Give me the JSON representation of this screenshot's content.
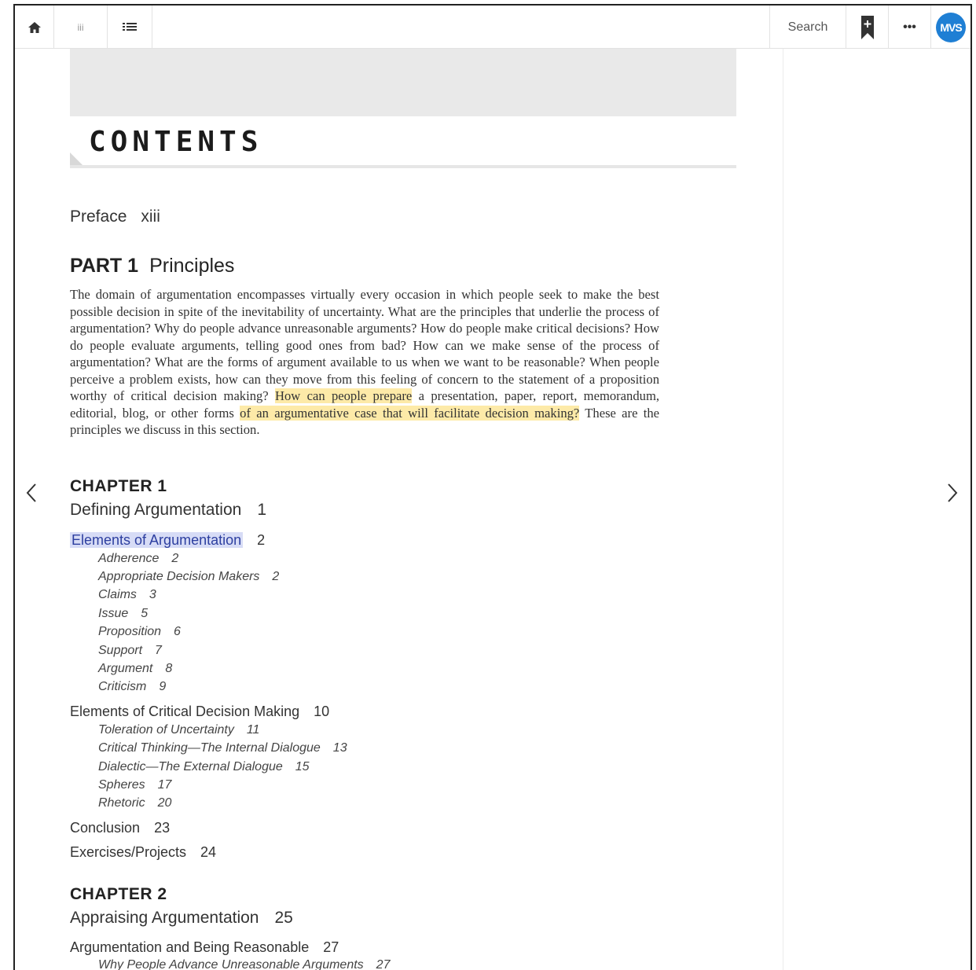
{
  "toolbar": {
    "home_icon": "home-icon",
    "pages_label": "iii",
    "toc_icon": "list-icon",
    "search_label": "Search",
    "bookmark_icon": "bookmark-add-icon",
    "more_label": "•••",
    "avatar_initials": "MVS",
    "avatar_color": "#1f7fd4"
  },
  "navigation": {
    "prev_icon": "chevron-left-icon",
    "next_icon": "chevron-right-icon"
  },
  "page": {
    "heading": "CONTENTS",
    "preface": {
      "label": "Preface",
      "page": "xiii"
    },
    "part": {
      "label": "PART 1",
      "title": "Principles"
    },
    "description": {
      "part1": "The domain of argumentation encompasses virtually every occasion in which people seek to make the best possible decision in spite of the inevitability of uncertainty. What are the principles that underlie the process of argumentation? Why do people advance unreasonable arguments? How do people make critical decisions? How do people evaluate arguments, telling good ones from bad? How can we make sense of the process of argumentation? What are the forms of argument available to us when we want to be reasonable? When people perceive a problem exists, how can they move from this feeling of concern to the statement of a proposition worthy of critical decision making? ",
      "highlight1": "How can people prepare",
      "part2": " a presentation, paper, report, memorandum, editorial, blog, or other forms ",
      "highlight2": "of an argumentative case that will facilitate decision making?",
      "part3": " These are the principles we discuss in this section.",
      "highlight_color": "#fdeaa8"
    },
    "chapter1": {
      "label": "CHAPTER 1",
      "title": "Defining Argumentation",
      "page": "1",
      "sections": [
        {
          "label": "Elements of Argumentation",
          "page": "2"
        },
        {
          "label": "Adherence",
          "page": "2"
        },
        {
          "label": "Appropriate Decision Makers",
          "page": "2"
        },
        {
          "label": "Claims",
          "page": "3"
        },
        {
          "label": "Issue",
          "page": "5"
        },
        {
          "label": "Proposition",
          "page": "6"
        },
        {
          "label": "Support",
          "page": "7"
        },
        {
          "label": "Argument",
          "page": "8"
        },
        {
          "label": "Criticism",
          "page": "9"
        },
        {
          "label": "Elements of Critical Decision Making",
          "page": "10"
        },
        {
          "label": "Toleration of Uncertainty",
          "page": "11"
        },
        {
          "label": "Critical Thinking—The Internal Dialogue",
          "page": "13"
        },
        {
          "label": "Dialectic—The External Dialogue",
          "page": "15"
        },
        {
          "label": "Spheres",
          "page": "17"
        },
        {
          "label": "Rhetoric",
          "page": "20"
        },
        {
          "label": "Conclusion",
          "page": "23"
        },
        {
          "label": "Exercises/Projects",
          "page": "24"
        }
      ]
    },
    "chapter2": {
      "label": "CHAPTER 2",
      "title": "Appraising Argumentation",
      "page": "25",
      "sections": [
        {
          "label": "Argumentation and Being Reasonable",
          "page": "27"
        },
        {
          "label": "Why People Advance Unreasonable Arguments",
          "page": "27"
        }
      ]
    }
  }
}
